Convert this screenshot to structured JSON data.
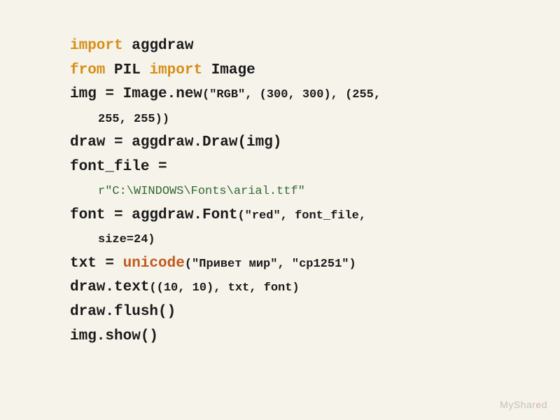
{
  "code": {
    "l1_kw_import": "import",
    "l1_mod": "aggdraw",
    "l2_kw_from": "from",
    "l2_mod": "PIL",
    "l2_kw_import": "import",
    "l2_name": "Image",
    "l3_lhs": "img = Image.new",
    "l3_args1": "(\"RGB\", (300, 300), (255,",
    "l3_args2": "255, 255))",
    "l4": "draw = aggdraw.Draw(img)",
    "l5_lhs": "font_file =",
    "l5_str": "r\"C:\\WINDOWS\\Fonts\\arial.ttf\"",
    "l6_lhs": "font = aggdraw.Font",
    "l6_arg1": "(\"red\", font_file,",
    "l6_arg2": "size=24)",
    "l7_lhs": "txt = ",
    "l7_fn": "unicode",
    "l7_args": "(\"Привет мир\", \"cp1251\")",
    "l8_lhs": "draw.text",
    "l8_args": "((10, 10), txt, font)",
    "l9": "draw.flush()",
    "l10": "img.show()"
  },
  "watermark": {
    "a": "MyShar",
    "b": "e",
    "c": "d"
  }
}
